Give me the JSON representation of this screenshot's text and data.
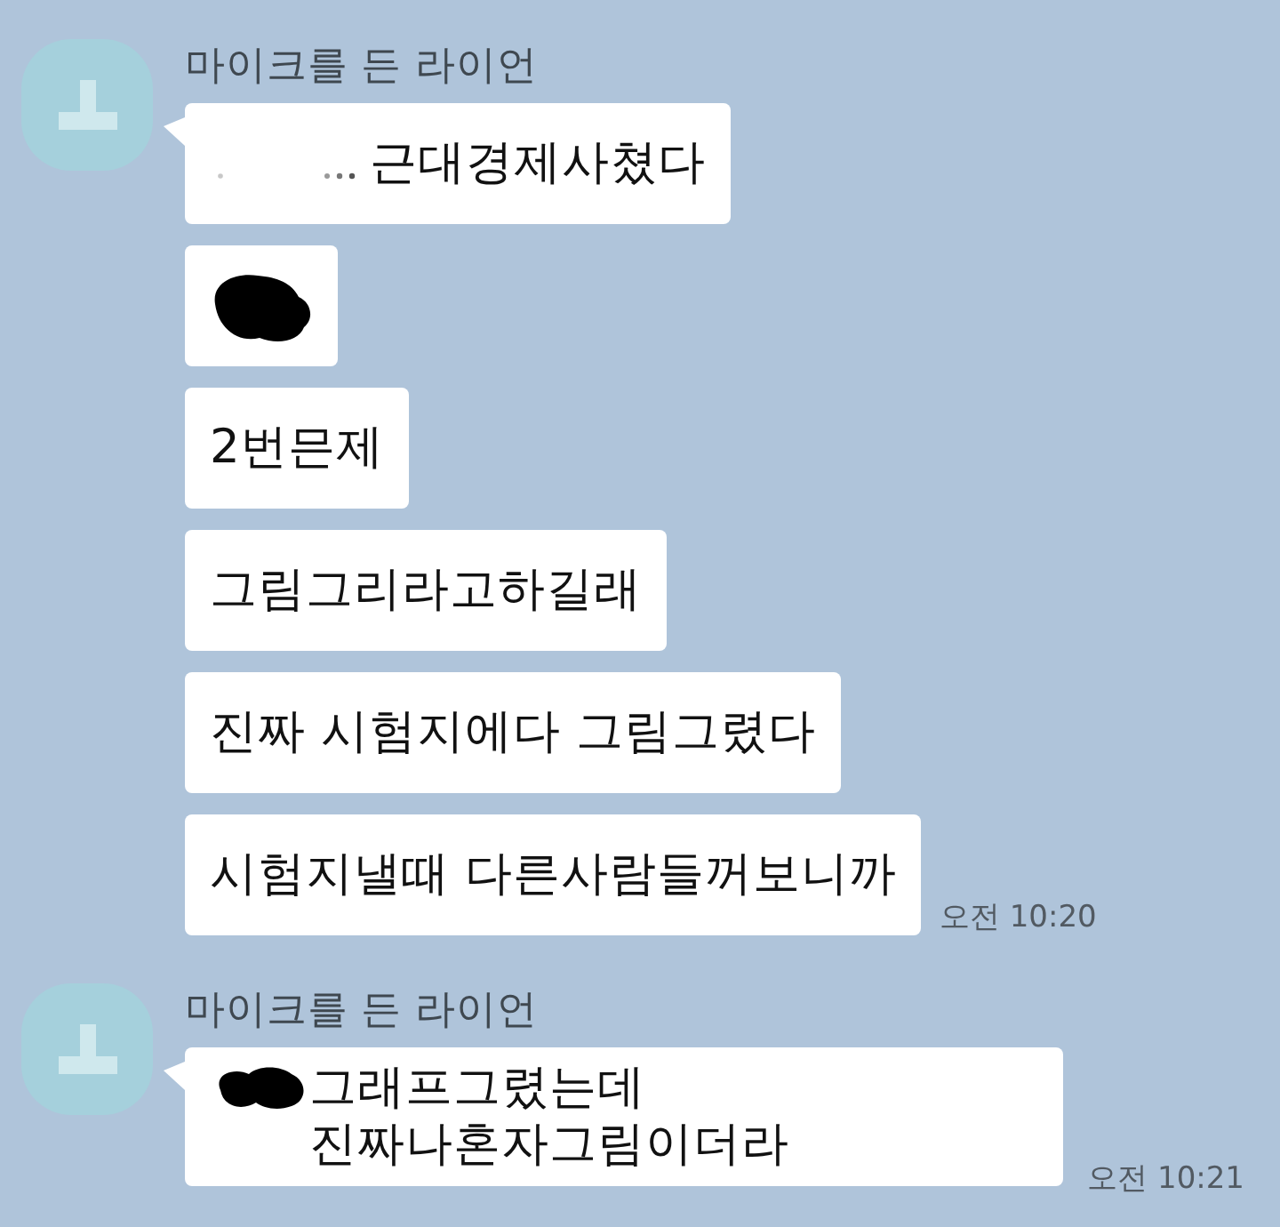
{
  "groups": [
    {
      "sender": "마이크를 든 라이언",
      "messages": [
        {
          "kind": "erased_text",
          "text": "근대경제사쳤다"
        },
        {
          "kind": "blot"
        },
        {
          "kind": "text",
          "text": "2번믄제"
        },
        {
          "kind": "text",
          "text": "그림그리라고하길래"
        },
        {
          "kind": "text",
          "text": "진짜 시험지에다 그림그렸다"
        },
        {
          "kind": "text",
          "text": "시험지낼때 다른사람들꺼보니까",
          "time": "오전 10:20"
        }
      ]
    },
    {
      "sender": "마이크를 든 라이언",
      "messages": [
        {
          "kind": "blotted_text",
          "text": "그래프그렸는데\n진짜나혼자그림이더라",
          "time": "오전 10:21"
        }
      ]
    }
  ]
}
